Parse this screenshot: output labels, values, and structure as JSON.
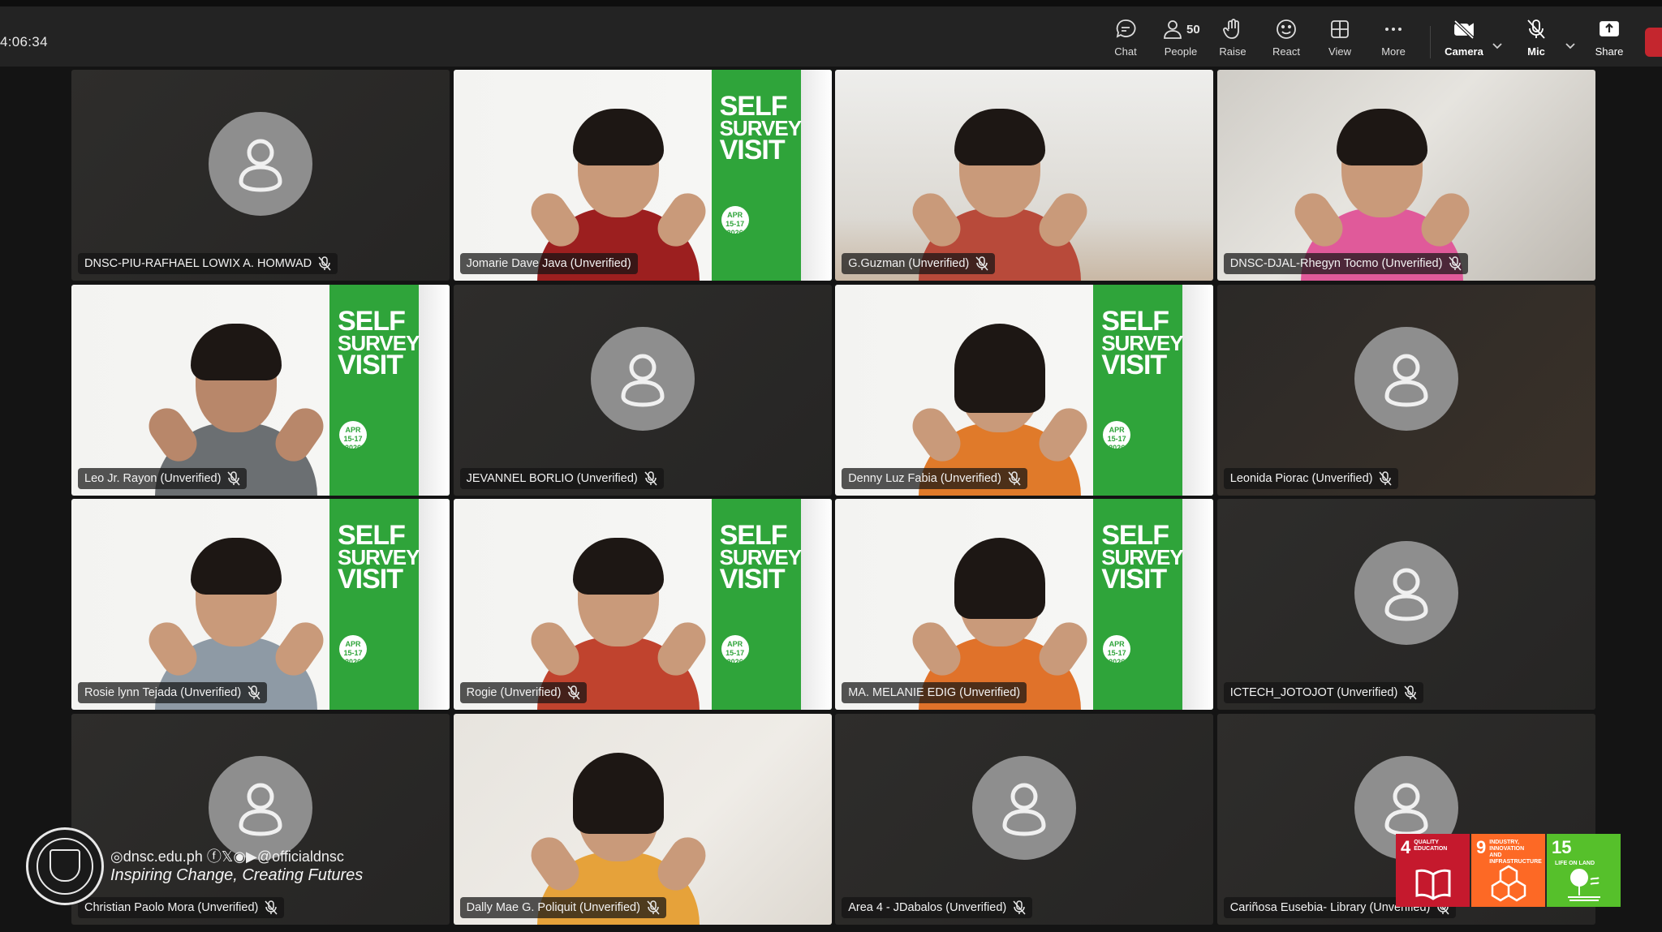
{
  "meeting": {
    "elapsed_time": "4:06:34"
  },
  "toolbar": {
    "chat": "Chat",
    "people": "People",
    "people_count": "50",
    "raise": "Raise",
    "react": "React",
    "view": "View",
    "more": "More",
    "camera": "Camera",
    "mic": "Mic",
    "share": "Share"
  },
  "participants": [
    {
      "name": "DNSC-PIU-RAFHAEL LOWIX A. HOMWAD",
      "video": false
    },
    {
      "name": "Jomarie Dave Java (Unverified)",
      "video": true
    },
    {
      "name": "G.Guzman (Unverified)",
      "video": true
    },
    {
      "name": "DNSC-DJAL-Rhegyn Tocmo (Unverified)",
      "video": true
    },
    {
      "name": "Leo Jr. Rayon (Unverified)",
      "video": true
    },
    {
      "name": "JEVANNEL BORLIO (Unverified)",
      "video": false
    },
    {
      "name": "Denny Luz Fabia (Unverified)",
      "video": true
    },
    {
      "name": "Leonida Piorac (Unverified)",
      "video": false
    },
    {
      "name": "Rosie lynn Tejada (Unverified)",
      "video": true
    },
    {
      "name": "Rogie (Unverified)",
      "video": true
    },
    {
      "name": "MA. MELANIE EDIG (Unverified)",
      "video": true
    },
    {
      "name": "ICTECH_JOTOJOT (Unverified)",
      "video": false
    },
    {
      "name": "Christian Paolo Mora (Unverified)",
      "video": false
    },
    {
      "name": "Dally Mae G. Poliquit (Unverified)",
      "video": true
    },
    {
      "name": "Area 4 - JDabalos (Unverified)",
      "video": false
    },
    {
      "name": "Cariñosa Eusebia- Library (Unverified)",
      "video": false
    }
  ],
  "poster": {
    "line1": "SELF",
    "line2": "SURVEY",
    "line3": "VISIT",
    "date": "APR 15-17 2026"
  },
  "branding": {
    "website": "dnsc.edu.ph",
    "social_handle": "@officialdnsc",
    "tagline": "Inspiring Change, Creating Futures"
  },
  "sdgs": [
    {
      "number": "4",
      "label": "QUALITY EDUCATION",
      "color": "#c5192d"
    },
    {
      "number": "9",
      "label": "INDUSTRY, INNOVATION AND INFRASTRUCTURE",
      "color": "#fd6925"
    },
    {
      "number": "15",
      "label": "LIFE ON LAND",
      "color": "#56c02b"
    }
  ],
  "colors": {
    "leave": "#c4262e",
    "poster_green": "#2fa43a"
  }
}
